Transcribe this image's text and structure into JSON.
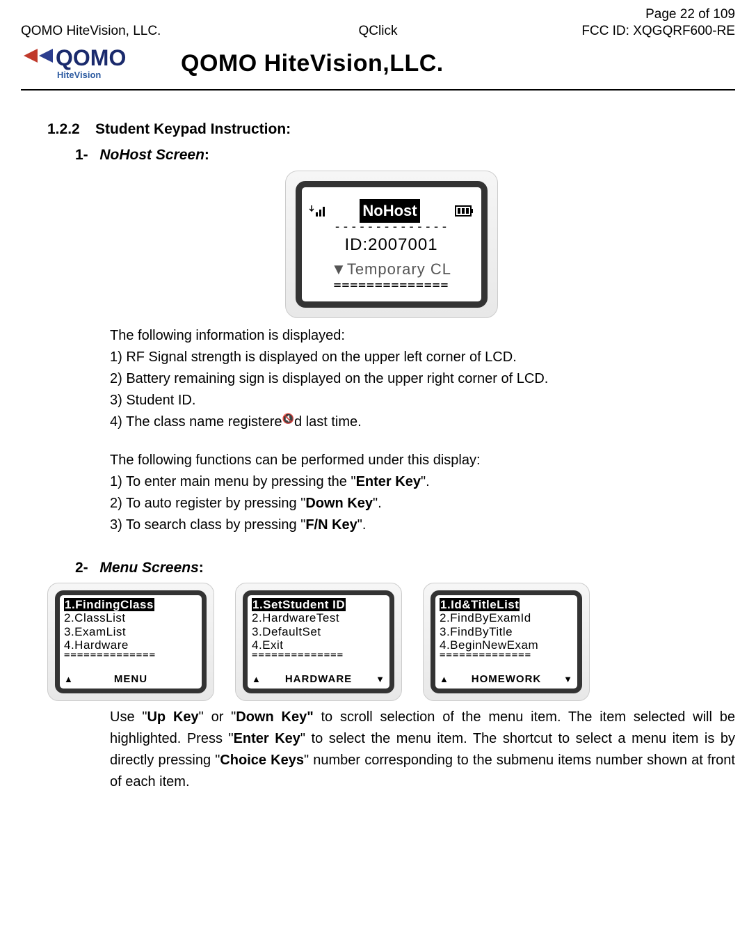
{
  "header": {
    "page_label": "Page 22 of 109",
    "company_left": "QOMO HiteVision, LLC.",
    "product_center": "QClick",
    "fcc_id": "FCC ID: XQGQRF600-RE",
    "logo_brand": "QOMO",
    "logo_sub": "HiteVision",
    "logo_title": "QOMO HiteVision,LLC."
  },
  "section": {
    "number": "1.2.2",
    "title": "Student Keypad Instruction:"
  },
  "item1": {
    "num": "1-",
    "title": "NoHost Screen",
    "colon": ":",
    "device": {
      "status": "NoHost",
      "dashes": "--------------",
      "id_line": "ID:2007001",
      "temp_arrow": "▼",
      "temp_text": "Temporary CL",
      "eq": "=============="
    },
    "infoDisplayedIntro": "The following information is displayed:",
    "info1": "1) RF Signal strength is displayed on the upper left corner of LCD.",
    "info2": "2) Battery remaining sign is displayed on the upper right corner of LCD.",
    "info3": "3) Student ID.",
    "info4": "4) The class name registered last time.",
    "funcIntro": "The following functions can be performed under this display:",
    "f1_a": "1) To enter main menu by pressing the \"",
    "f1_key": "Enter Key",
    "f1_b": "\".",
    "f2_a": "2) To auto register by pressing \"",
    "f2_key": "Down Key",
    "f2_b": "\".",
    "f3_a": "3) To search class by pressing \"",
    "f3_key": "F/N Key",
    "f3_b": "\"."
  },
  "item2": {
    "num": "2-",
    "title": "Menu Screens",
    "colon": ":",
    "menus": [
      {
        "hi": "1.FindingClass",
        "l2": "2.ClassList",
        "l3": "3.ExamList",
        "l4": "4.Hardware",
        "eq": "==============",
        "footer": "MENU",
        "showDown": false
      },
      {
        "hi": "1.SetStudent ID",
        "l2": "2.HardwareTest",
        "l3": "3.DefaultSet",
        "l4": "4.Exit",
        "eq": "==============",
        "footer": "HARDWARE",
        "showDown": true
      },
      {
        "hi": "1.Id&TitleList",
        "l2": "2.FindByExamId",
        "l3": "3.FindByTitle",
        "l4": "4.BeginNewExam",
        "eq": "==============",
        "footer": "HOMEWORK",
        "showDown": true
      }
    ],
    "para_a": "Use \"",
    "para_key1": "Up Key",
    "para_b": "\" or \"",
    "para_key2": "Down Key\"",
    "para_c": " to scroll selection of the menu item. The item selected will be highlighted. Press \"",
    "para_key3": "Enter Key",
    "para_d": "\" to select the menu item. The shortcut to select a menu item is by directly pressing \"",
    "para_key4": "Choice Keys",
    "para_e": "\" number corresponding to the submenu items number shown at front of each item."
  }
}
